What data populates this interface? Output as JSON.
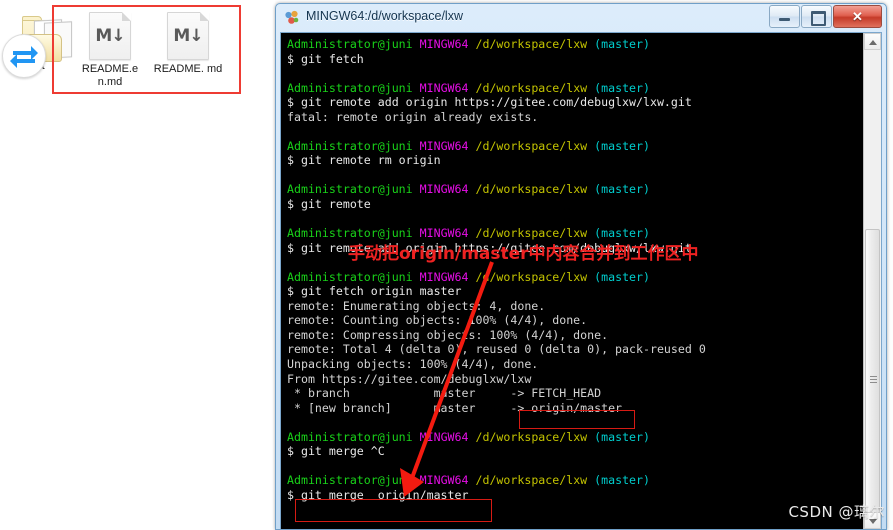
{
  "desktop": {
    "folder": {
      "label": ".git",
      "icon": "folder-icon",
      "overlay_icon": "sync-refresh-icon"
    },
    "files": [
      {
        "name": "README.e\nn.md",
        "icon": "markdown-file-icon",
        "glyph": "M↓"
      },
      {
        "name": "README.\nmd",
        "icon": "markdown-file-icon",
        "glyph": "M↓"
      }
    ],
    "selection_highlight_color": "#ee3b33"
  },
  "window": {
    "title": "MINGW64:/d/workspace/lxw",
    "icon": "mingw-logo-icon",
    "buttons": {
      "minimize": {
        "label": "–",
        "name": "minimize-button"
      },
      "maximize": {
        "label": "□",
        "name": "maximize-button"
      },
      "close": {
        "label": "✕",
        "name": "close-button"
      }
    }
  },
  "terminal": {
    "prompt": {
      "user": "Administrator@juni",
      "host": "MINGW64",
      "path": "/d/workspace/lxw",
      "branch": "(master)",
      "sigil": "$"
    },
    "colors": {
      "user": "#19d219",
      "host": "#e60ee6",
      "path": "#c3c300",
      "branch": "#00cdcd",
      "output": "#d3d3d3",
      "background": "#000000"
    },
    "blocks": [
      {
        "type": "prompt"
      },
      {
        "type": "cmd",
        "text": "$ git fetch"
      },
      {
        "type": "blank"
      },
      {
        "type": "prompt"
      },
      {
        "type": "cmd",
        "text": "$ git remote add origin https://gitee.com/debuglxw/lxw.git"
      },
      {
        "type": "out",
        "text": "fatal: remote origin already exists."
      },
      {
        "type": "blank"
      },
      {
        "type": "prompt"
      },
      {
        "type": "cmd",
        "text": "$ git remote rm origin"
      },
      {
        "type": "blank"
      },
      {
        "type": "prompt"
      },
      {
        "type": "cmd",
        "text": "$ git remote"
      },
      {
        "type": "blank"
      },
      {
        "type": "prompt"
      },
      {
        "type": "cmd",
        "text": "$ git remote add origin https://gitee.com/debuglxw/lxw.git"
      },
      {
        "type": "blank"
      },
      {
        "type": "prompt"
      },
      {
        "type": "cmd",
        "text": "$ git fetch origin master"
      },
      {
        "type": "out",
        "text": "remote: Enumerating objects: 4, done."
      },
      {
        "type": "out",
        "text": "remote: Counting objects: 100% (4/4), done."
      },
      {
        "type": "out",
        "text": "remote: Compressing objects: 100% (4/4), done."
      },
      {
        "type": "out",
        "text": "remote: Total 4 (delta 0), reused 0 (delta 0), pack-reused 0"
      },
      {
        "type": "out",
        "text": "Unpacking objects: 100% (4/4), done."
      },
      {
        "type": "out",
        "text": "From https://gitee.com/debuglxw/lxw"
      },
      {
        "type": "out",
        "text": " * branch            master     -> FETCH_HEAD"
      },
      {
        "type": "out",
        "text": " * [new branch]      master     -> origin/master"
      },
      {
        "type": "blank"
      },
      {
        "type": "prompt"
      },
      {
        "type": "cmd",
        "text": "$ git merge ^C"
      },
      {
        "type": "blank"
      },
      {
        "type": "prompt"
      },
      {
        "type": "cmd",
        "text": "$ git merge  origin/master"
      }
    ],
    "scrollbar": {
      "up_arrow": "▲",
      "down_arrow": "▼"
    }
  },
  "annotations": {
    "note_text": "手动把origin/master中内容合并到工作区中",
    "note_color": "#ee2222",
    "box_color": "#d61b14",
    "arrow_color": "#f31b10",
    "highlighted_terms": [
      "origin/master",
      "git merge  origin/master"
    ]
  },
  "watermark": "CSDN @璃尔"
}
